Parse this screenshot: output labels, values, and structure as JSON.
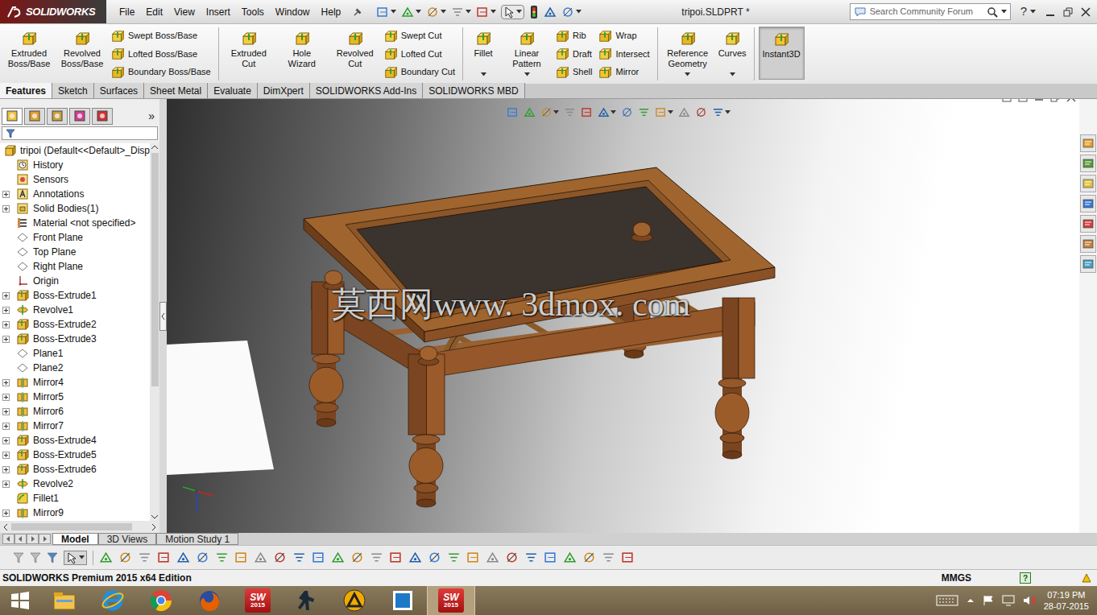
{
  "title_bar": {
    "logo": "SOLIDWORKS",
    "menus": [
      "File",
      "Edit",
      "View",
      "Insert",
      "Tools",
      "Window",
      "Help"
    ],
    "document_title": "tripoi.SLDPRT *",
    "search": {
      "placeholder": "Search Community Forum"
    },
    "help": "?"
  },
  "ribbon": {
    "groups": [
      {
        "kind": "large",
        "separator_after": false,
        "items": [
          {
            "label": "Extruded Boss/Base",
            "dropdown": false,
            "pressed": false
          },
          {
            "label": "Revolved Boss/Base",
            "dropdown": false,
            "pressed": false
          }
        ]
      },
      {
        "kind": "stack",
        "separator_after": true,
        "items": [
          {
            "label": "Swept Boss/Base"
          },
          {
            "label": "Lofted Boss/Base"
          },
          {
            "label": "Boundary Boss/Base"
          }
        ]
      },
      {
        "kind": "large",
        "separator_after": false,
        "items": [
          {
            "label": "Extruded Cut",
            "dropdown": false,
            "pressed": false
          },
          {
            "label": "Hole Wizard",
            "dropdown": false,
            "pressed": false
          },
          {
            "label": "Revolved Cut",
            "dropdown": false,
            "pressed": false
          }
        ]
      },
      {
        "kind": "stack",
        "separator_after": true,
        "items": [
          {
            "label": "Swept Cut"
          },
          {
            "label": "Lofted Cut"
          },
          {
            "label": "Boundary Cut"
          }
        ]
      },
      {
        "kind": "large",
        "separator_after": false,
        "items": [
          {
            "label": "Fillet",
            "dropdown": true,
            "pressed": false
          },
          {
            "label": "Linear Pattern",
            "dropdown": true,
            "pressed": false
          }
        ]
      },
      {
        "kind": "stack",
        "separator_after": false,
        "items": [
          {
            "label": "Rib"
          },
          {
            "label": "Draft"
          },
          {
            "label": "Shell"
          }
        ]
      },
      {
        "kind": "stack",
        "separator_after": true,
        "items": [
          {
            "label": "Wrap"
          },
          {
            "label": "Intersect"
          },
          {
            "label": "Mirror"
          }
        ]
      },
      {
        "kind": "large",
        "separator_after": true,
        "items": [
          {
            "label": "Reference Geometry",
            "dropdown": true,
            "pressed": false
          },
          {
            "label": "Curves",
            "dropdown": true,
            "pressed": false
          }
        ]
      },
      {
        "kind": "large",
        "separator_after": false,
        "items": [
          {
            "label": "Instant3D",
            "dropdown": false,
            "pressed": true
          }
        ]
      }
    ]
  },
  "tabs": [
    {
      "label": "Features",
      "selected": true
    },
    {
      "label": "Sketch",
      "selected": false
    },
    {
      "label": "Surfaces",
      "selected": false
    },
    {
      "label": "Sheet Metal",
      "selected": false
    },
    {
      "label": "Evaluate",
      "selected": false
    },
    {
      "label": "DimXpert",
      "selected": false
    },
    {
      "label": "SOLIDWORKS Add-Ins",
      "selected": false
    },
    {
      "label": "SOLIDWORKS MBD",
      "selected": false
    }
  ],
  "feature_manager": {
    "more": "»",
    "tree": [
      {
        "label": "tripoi  (Default<<Default>_Disp",
        "kind": "part",
        "expandable": false
      },
      {
        "label": "History",
        "kind": "history",
        "expandable": false
      },
      {
        "label": "Sensors",
        "kind": "sensor",
        "expandable": false
      },
      {
        "label": "Annotations",
        "kind": "annotation",
        "expandable": true
      },
      {
        "label": "Solid Bodies(1)",
        "kind": "bodies",
        "expandable": true
      },
      {
        "label": "Material <not specified>",
        "kind": "material",
        "expandable": false
      },
      {
        "label": "Front Plane",
        "kind": "plane",
        "expandable": false
      },
      {
        "label": "Top Plane",
        "kind": "plane",
        "expandable": false
      },
      {
        "label": "Right Plane",
        "kind": "plane",
        "expandable": false
      },
      {
        "label": "Origin",
        "kind": "origin",
        "expandable": false
      },
      {
        "label": "Boss-Extrude1",
        "kind": "extrude",
        "expandable": true
      },
      {
        "label": "Revolve1",
        "kind": "revolve",
        "expandable": true
      },
      {
        "label": "Boss-Extrude2",
        "kind": "extrude",
        "expandable": true
      },
      {
        "label": "Boss-Extrude3",
        "kind": "extrude",
        "expandable": true
      },
      {
        "label": "Plane1",
        "kind": "plane",
        "expandable": false
      },
      {
        "label": "Plane2",
        "kind": "plane",
        "expandable": false
      },
      {
        "label": "Mirror4",
        "kind": "mirror",
        "expandable": true
      },
      {
        "label": "Mirror5",
        "kind": "mirror",
        "expandable": true
      },
      {
        "label": "Mirror6",
        "kind": "mirror",
        "expandable": true
      },
      {
        "label": "Mirror7",
        "kind": "mirror",
        "expandable": true
      },
      {
        "label": "Boss-Extrude4",
        "kind": "extrude",
        "expandable": true
      },
      {
        "label": "Boss-Extrude5",
        "kind": "extrude",
        "expandable": true
      },
      {
        "label": "Boss-Extrude6",
        "kind": "extrude",
        "expandable": true
      },
      {
        "label": "Revolve2",
        "kind": "revolve",
        "expandable": true
      },
      {
        "label": "Fillet1",
        "kind": "fillet",
        "expandable": false
      },
      {
        "label": "Mirror9",
        "kind": "mirror",
        "expandable": true
      }
    ]
  },
  "viewport": {
    "watermark": "莫西网www. 3dmox. com"
  },
  "bottom_tabs": [
    {
      "label": "Model",
      "selected": true
    },
    {
      "label": "3D Views",
      "selected": false
    },
    {
      "label": "Motion Study 1",
      "selected": false
    }
  ],
  "status_bar": {
    "edition": "SOLIDWORKS Premium 2015 x64 Edition",
    "units": "MMGS",
    "help": "?"
  },
  "taskbar": {
    "apps": [
      {
        "kind": "explorer",
        "active": false
      },
      {
        "kind": "ie",
        "active": false
      },
      {
        "kind": "chrome",
        "active": false
      },
      {
        "kind": "firefox",
        "active": false
      },
      {
        "kind": "solidworks",
        "active": false,
        "logo": "SW",
        "badge": "2015"
      },
      {
        "kind": "game",
        "active": false
      },
      {
        "kind": "triangle",
        "active": false
      },
      {
        "kind": "blue",
        "active": false
      },
      {
        "kind": "solidworks",
        "active": true,
        "logo": "SW",
        "badge": "2015"
      }
    ],
    "time": "07:19 PM",
    "date": "28-07-2015"
  }
}
